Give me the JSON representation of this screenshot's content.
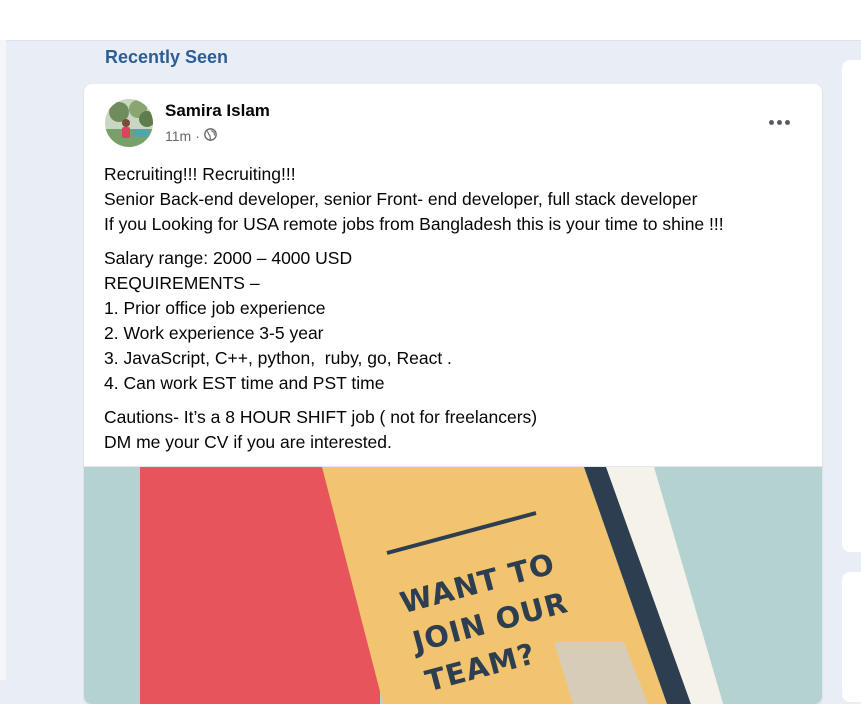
{
  "section": {
    "title": "Recently Seen"
  },
  "post": {
    "author": "Samira Islam",
    "time": "11m",
    "separator": "·",
    "audience_icon": "globe-icon",
    "more_icon": "more-options-icon",
    "paragraphs": [
      [
        "Recruiting!!! Recruiting!!!",
        "Senior Back-end developer, senior Front- end developer, full stack developer",
        "If you Looking for USA remote jobs from Bangladesh this is your time to shine !!!"
      ],
      [
        "Salary range: 2000 – 4000 USD",
        "REQUIREMENTS –",
        "1. Prior office job experience",
        "2. Work experience 3-5 year",
        "3. JavaScript, C++, python,  ruby, go, React .",
        "4. Can work EST time and PST time"
      ],
      [
        "Cautions- It’s a 8 HOUR SHIFT job ( not for freelancers)",
        "DM me your CV if you are interested."
      ]
    ],
    "image": {
      "lines": [
        "WANT TO",
        "JOIN OUR",
        "TEAM?"
      ]
    }
  },
  "colors": {
    "section_title": "#2a5e95",
    "image_teal": "#b4d3d0",
    "image_red": "#e8545c",
    "image_yellow": "#f2c46f",
    "image_navy": "#2c3e50"
  }
}
